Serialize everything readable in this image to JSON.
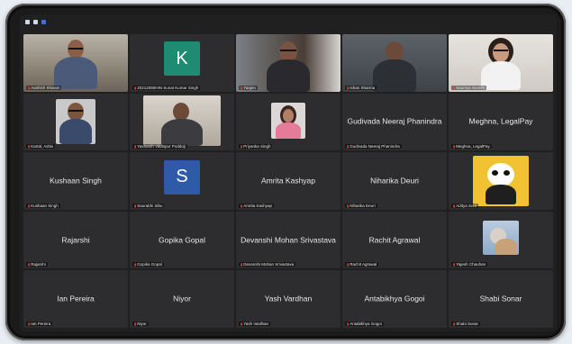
{
  "colors": {
    "accent": "#3d6fe0",
    "mic_off": "#e74c3c"
  },
  "icons": [
    "menu-icon",
    "grid-icon",
    "layout-icon",
    "muted-mic-icon"
  ],
  "participants": [
    {
      "label": "Aashish Shivam"
    },
    {
      "label": "20212080HIN Sunat Kumar Singh",
      "initial": "K",
      "avatar_color": "#1e8b72"
    },
    {
      "label": "Yaajen"
    },
    {
      "label": "Ishan Sharma"
    },
    {
      "label": "Saumya Sumith"
    },
    {
      "label": "Kartal, Ashis"
    },
    {
      "label": "Yashanth Vikaspur Poddoji"
    },
    {
      "label": "Priyanka Singh"
    },
    {
      "name": "Gudivada Neeraj Phanindra",
      "label": "Gudivada Neeraj Phanindra"
    },
    {
      "name": "Meghna, LegalPay",
      "label": "Meghna, LegalPay"
    },
    {
      "name": "Kushaan Singh",
      "label": "Kushaan Singh"
    },
    {
      "label": "Saurabhi Sibu",
      "initial": "S",
      "avatar_color": "#2f5aa8"
    },
    {
      "name": "Amrita Kashyap",
      "label": "Amrita Kashyap"
    },
    {
      "name": "Niharika Deuri",
      "label": "Niharika Deuri"
    },
    {
      "label": "Aditya Soni"
    },
    {
      "name": "Rajarshi",
      "label": "Rajarshi"
    },
    {
      "name": "Gopika Gopal",
      "label": "Gopika Gopal"
    },
    {
      "name": "Devanshi Mohan Srivastava",
      "label": "Devanshi Mohan Srivastava"
    },
    {
      "name": "Rachit Agrawal",
      "label": "Rachit Agrawal"
    },
    {
      "label": "Yajesh Chauhan"
    },
    {
      "name": "Ian Pereira",
      "label": "Ian Pereira"
    },
    {
      "name": "Niyor",
      "label": "Niyor"
    },
    {
      "name": "Yash Vardhan",
      "label": "Yash Vardhan"
    },
    {
      "name": "Antabikhya Gogoi",
      "label": "Antabikhya Gogoi"
    },
    {
      "name": "Shabi Sonar",
      "label": "Shabi Sonar"
    }
  ]
}
